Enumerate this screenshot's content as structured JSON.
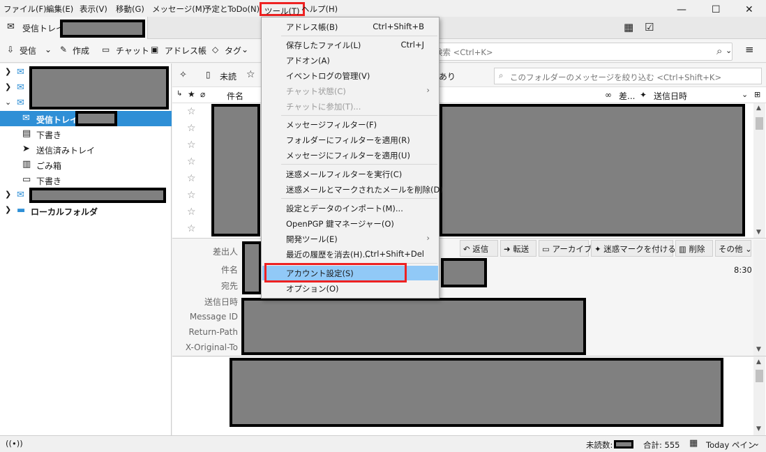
{
  "menubar": {
    "items": [
      "ファイル(F)",
      "編集(E)",
      "表示(V)",
      "移動(G)",
      "メッセージ(M)",
      "予定とToDo(N)",
      "ツール(T)",
      "ヘルプ(H)"
    ],
    "window_controls": [
      "—",
      "☐",
      "✕"
    ]
  },
  "tabs": {
    "inbox": "受信トレイ"
  },
  "toolbar": {
    "get_mail": "受信",
    "write": "作成",
    "chat": "チャット",
    "address_book": "アドレス帳",
    "tag": "タグ",
    "search_placeholder": "検索 <Ctrl+K>"
  },
  "folders": {
    "inbox": "受信トレイ",
    "drafts": "下書き",
    "sent": "送信済みトレイ",
    "trash": "ごみ箱",
    "drafts2": "下書き",
    "local": "ローカルフォルダ"
  },
  "quickfilter": {
    "unread": "未読",
    "attachment": "あり",
    "filter_placeholder": "このフォルダーのメッセージを絞り込む <Ctrl+Shift+K>"
  },
  "columns": {
    "subject": "件名",
    "sender": "差...",
    "date": "送信日時"
  },
  "message_header": {
    "labels": [
      "差出人",
      "件名",
      "宛先",
      "送信日時",
      "Message ID",
      "Return-Path",
      "X-Original-To"
    ],
    "time": "8:30",
    "buttons": {
      "reply": "返信",
      "forward": "転送",
      "archive": "アーカイブ",
      "junk": "迷惑マークを付ける",
      "delete": "削除",
      "more": "その他"
    }
  },
  "statusbar": {
    "unread": "未読数:",
    "total": "合計: 555",
    "today_pane": "Today ペイン"
  },
  "tools_menu": {
    "items": [
      {
        "label": "アドレス帳(B)",
        "shortcut": "Ctrl+Shift+B"
      },
      {
        "label": "保存したファイル(L)",
        "shortcut": "Ctrl+J"
      },
      {
        "label": "アドオン(A)",
        "shortcut": ""
      },
      {
        "label": "イベントログの管理(V)",
        "shortcut": ""
      },
      {
        "label": "チャット状態(C)",
        "shortcut": ""
      },
      {
        "label": "チャットに参加(T)...",
        "shortcut": ""
      },
      {
        "label": "メッセージフィルター(F)",
        "shortcut": ""
      },
      {
        "label": "フォルダーにフィルターを適用(R)",
        "shortcut": ""
      },
      {
        "label": "メッセージにフィルターを適用(U)",
        "shortcut": ""
      },
      {
        "label": "迷惑メールフィルターを実行(C)",
        "shortcut": ""
      },
      {
        "label": "迷惑メールとマークされたメールを削除(D)",
        "shortcut": ""
      },
      {
        "label": "設定とデータのインポート(M)...",
        "shortcut": ""
      },
      {
        "label": "OpenPGP 鍵マネージャー(O)",
        "shortcut": ""
      },
      {
        "label": "開発ツール(E)",
        "shortcut": ""
      },
      {
        "label": "最近の履歴を消去(H)...",
        "shortcut": "Ctrl+Shift+Del"
      },
      {
        "label": "アカウント設定(S)",
        "shortcut": ""
      },
      {
        "label": "オプション(O)",
        "shortcut": ""
      }
    ]
  },
  "colors": {
    "selection": "#2e8fd6",
    "menu_highlight": "#91c9f7",
    "annotation_red": "#e22222",
    "redaction": "#808080"
  }
}
